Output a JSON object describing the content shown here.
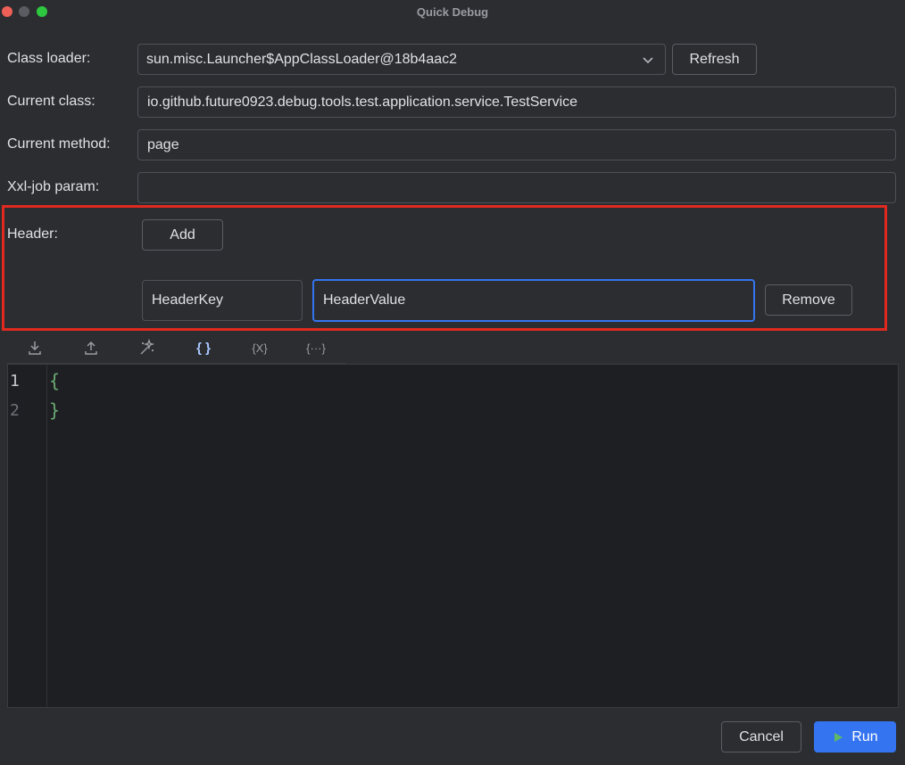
{
  "window": {
    "title": "Quick Debug"
  },
  "form": {
    "class_loader_label": "Class loader:",
    "class_loader_value": "sun.misc.Launcher$AppClassLoader@18b4aac2",
    "refresh_label": "Refresh",
    "current_class_label": "Current class:",
    "current_class_value": "io.github.future0923.debug.tools.test.application.service.TestService",
    "current_method_label": "Current method:",
    "current_method_value": "page",
    "xxl_job_label": "Xxl-job param:",
    "xxl_job_value": ""
  },
  "header": {
    "label": "Header:",
    "add_label": "Add",
    "key_value": "HeaderKey",
    "value_value": "HeaderValue",
    "remove_label": "Remove"
  },
  "toolbar": {
    "icons": [
      "import-icon",
      "export-icon",
      "magic-wand-icon",
      "json-braces-icon",
      "variable-icon",
      "expression-icon"
    ]
  },
  "editor": {
    "lines": [
      {
        "number": "1",
        "text": "{"
      },
      {
        "number": "2",
        "text": "}"
      }
    ]
  },
  "footer": {
    "cancel_label": "Cancel",
    "run_label": "Run"
  },
  "colors": {
    "accent": "#3574f0",
    "highlight": "#e02a1f",
    "code_brace": "#6aab73"
  }
}
